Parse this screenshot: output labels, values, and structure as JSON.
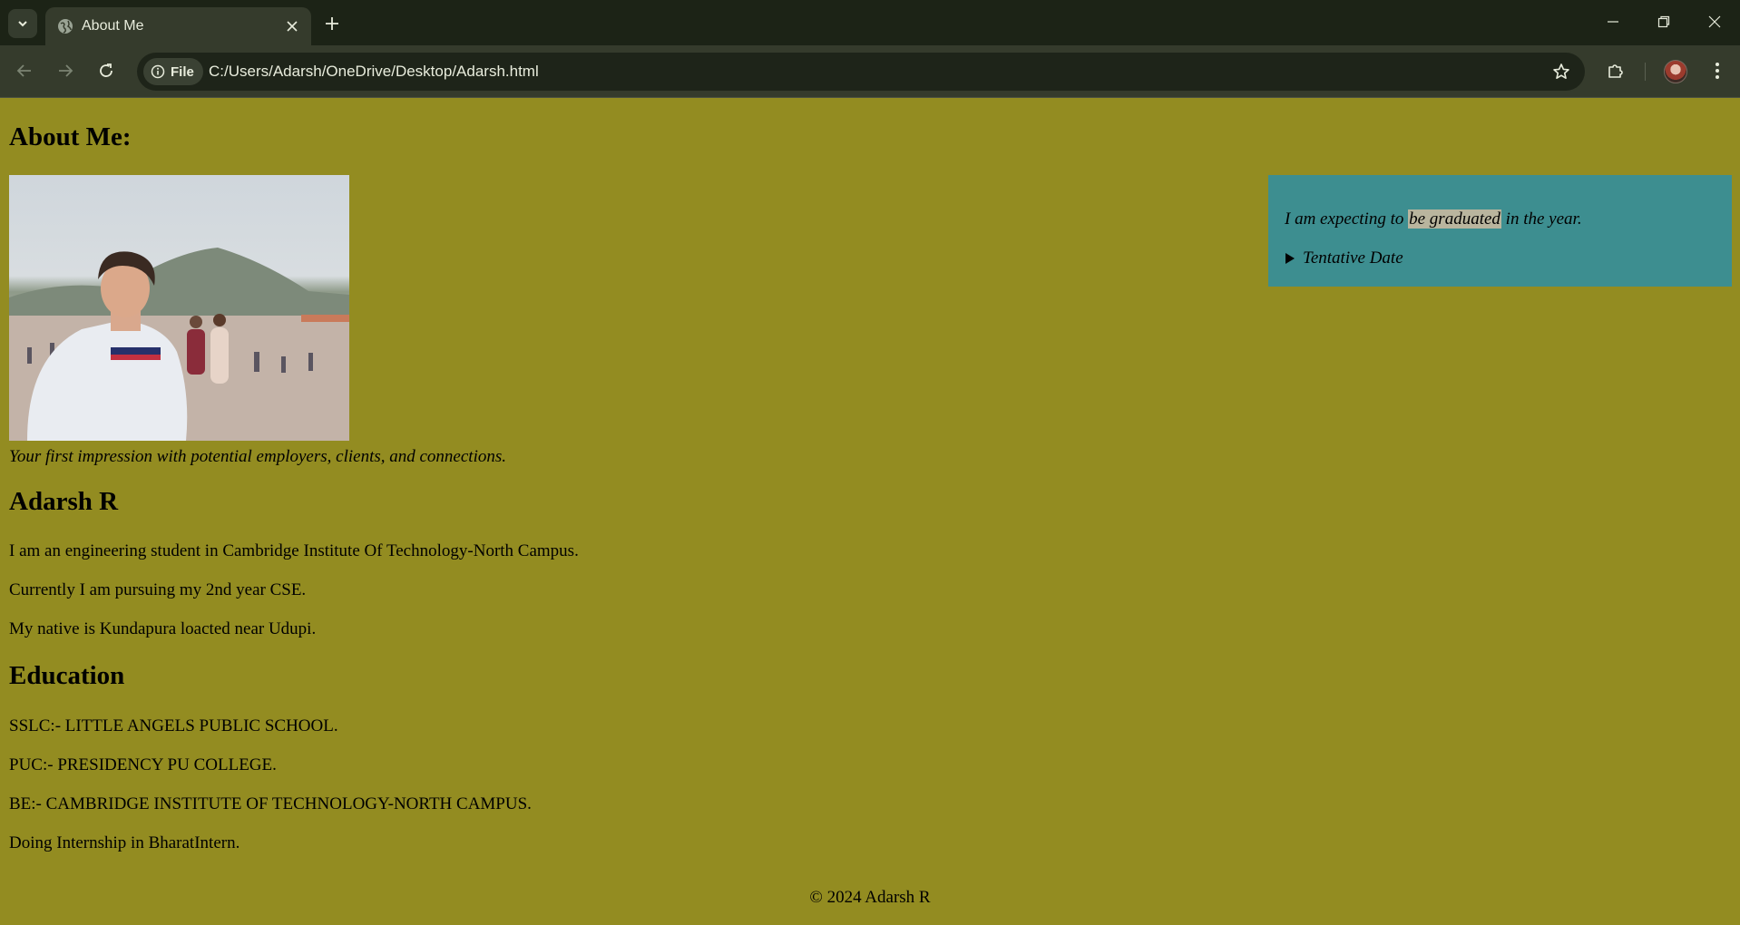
{
  "browser": {
    "tab_title": "About Me",
    "address_chip": "File",
    "url": "C:/Users/Adarsh/OneDrive/Desktop/Adarsh.html",
    "accent_bg": "#1c2316",
    "toolbar_bg": "#353b2c"
  },
  "page": {
    "background": "#938c21",
    "title": "About Me:",
    "photo_caption": "Your first impression with potential employers, clients, and connections.",
    "name": "Adarsh R",
    "intro": [
      "I am an engineering student in Cambridge Institute Of Technology-North Campus.",
      "Currently I am pursuing my 2nd year CSE.",
      "My native is Kundapura loacted near Udupi."
    ],
    "education_heading": "Education",
    "education": [
      "SSLC:- LITTLE ANGELS PUBLIC SCHOOL.",
      "PUC:- PRESIDENCY PU COLLEGE.",
      "BE:- CAMBRIDGE INSTITUTE OF TECHNOLOGY-NORTH CAMPUS.",
      "Doing Internship in BharatIntern."
    ],
    "aside": {
      "before": "I am expecting to ",
      "highlight": "be graduated",
      "after": " in the year.",
      "details_summary": "Tentative Date",
      "background": "#3d8e90"
    },
    "footer": "© 2024 Adarsh R"
  }
}
